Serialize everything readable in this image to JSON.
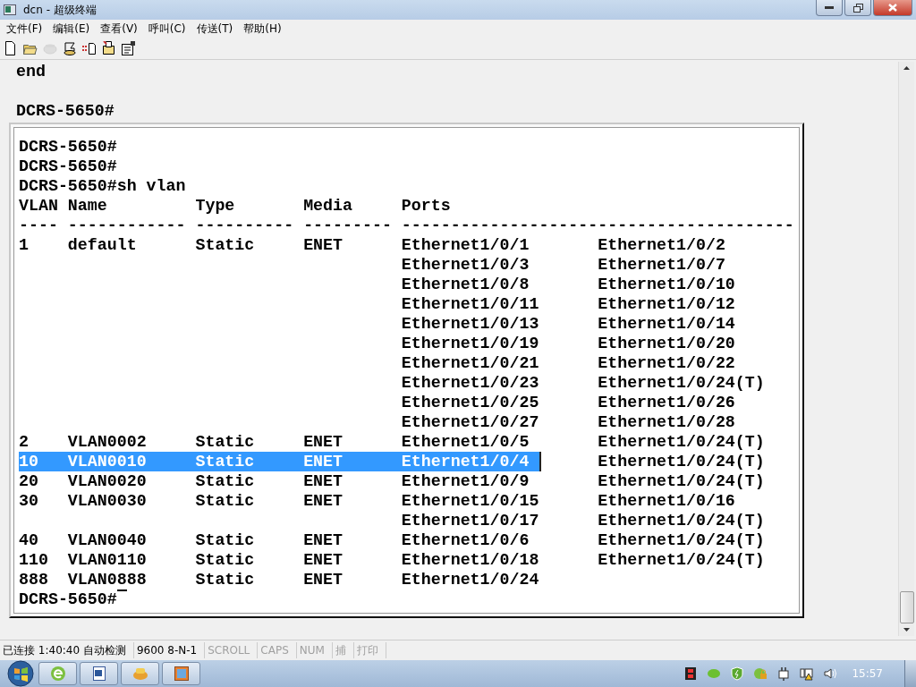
{
  "window": {
    "title": "dcn - 超级终端"
  },
  "menu": [
    "文件(F)",
    "编辑(E)",
    "查看(V)",
    "呼叫(C)",
    "传送(T)",
    "帮助(H)"
  ],
  "toolbar": [
    {
      "kind": "new"
    },
    {
      "kind": "open"
    },
    {
      "kind": "call",
      "disabled": true
    },
    {
      "kind": "hangup",
      "disabled": false
    },
    {
      "kind": "send"
    },
    {
      "kind": "receive"
    },
    {
      "kind": "properties"
    }
  ],
  "terminal": {
    "upper_lines": [
      "end",
      "DCRS-5650#"
    ],
    "prompt_lines": [
      "DCRS-5650#",
      "DCRS-5650#",
      "DCRS-5650#sh vlan"
    ],
    "vlan_table": {
      "columns": [
        "VLAN",
        "Name",
        "Type",
        "Media",
        "Ports"
      ],
      "separators": [
        "----",
        "------------",
        "----------",
        "---------",
        "----------------------------------------"
      ],
      "rows": [
        {
          "vlan": "1",
          "name": "default",
          "type": "Static",
          "media": "ENET",
          "selected": false,
          "ports": [
            "Ethernet1/0/1",
            "Ethernet1/0/2",
            "Ethernet1/0/3",
            "Ethernet1/0/7",
            "Ethernet1/0/8",
            "Ethernet1/0/10",
            "Ethernet1/0/11",
            "Ethernet1/0/12",
            "Ethernet1/0/13",
            "Ethernet1/0/14",
            "Ethernet1/0/19",
            "Ethernet1/0/20",
            "Ethernet1/0/21",
            "Ethernet1/0/22",
            "Ethernet1/0/23",
            "Ethernet1/0/24(T)",
            "Ethernet1/0/25",
            "Ethernet1/0/26",
            "Ethernet1/0/27",
            "Ethernet1/0/28"
          ]
        },
        {
          "vlan": "2",
          "name": "VLAN0002",
          "type": "Static",
          "media": "ENET",
          "selected": false,
          "ports": [
            "Ethernet1/0/5",
            "Ethernet1/0/24(T)"
          ]
        },
        {
          "vlan": "10",
          "name": "VLAN0010",
          "type": "Static",
          "media": "ENET",
          "selected": true,
          "ports": [
            "Ethernet1/0/4",
            "Ethernet1/0/24(T)"
          ]
        },
        {
          "vlan": "20",
          "name": "VLAN0020",
          "type": "Static",
          "media": "ENET",
          "selected": false,
          "ports": [
            "Ethernet1/0/9",
            "Ethernet1/0/24(T)"
          ]
        },
        {
          "vlan": "30",
          "name": "VLAN0030",
          "type": "Static",
          "media": "ENET",
          "selected": false,
          "ports": [
            "Ethernet1/0/15",
            "Ethernet1/0/16",
            "Ethernet1/0/17",
            "Ethernet1/0/24(T)"
          ]
        },
        {
          "vlan": "40",
          "name": "VLAN0040",
          "type": "Static",
          "media": "ENET",
          "selected": false,
          "ports": [
            "Ethernet1/0/6",
            "Ethernet1/0/24(T)"
          ]
        },
        {
          "vlan": "110",
          "name": "VLAN0110",
          "type": "Static",
          "media": "ENET",
          "selected": false,
          "ports": [
            "Ethernet1/0/18",
            "Ethernet1/0/24(T)"
          ]
        },
        {
          "vlan": "888",
          "name": "VLAN0888",
          "type": "Static",
          "media": "ENET",
          "selected": false,
          "ports": [
            "Ethernet1/0/24"
          ]
        }
      ]
    },
    "final_prompt": "DCRS-5650#"
  },
  "status_bar": [
    {
      "text": "已连接 1:40:40 自动检测",
      "disabled": false
    },
    {
      "text": "9600 8-N-1",
      "disabled": false
    },
    {
      "text": "SCROLL",
      "disabled": true
    },
    {
      "text": "CAPS",
      "disabled": true
    },
    {
      "text": "NUM",
      "disabled": true
    },
    {
      "text": "捕",
      "disabled": true
    },
    {
      "text": "打印",
      "disabled": true
    }
  ],
  "taskbar": {
    "apps": [
      {
        "kind": "browser"
      },
      {
        "kind": "word"
      },
      {
        "kind": "hyperterminal"
      },
      {
        "kind": "window"
      }
    ],
    "tray": [
      {
        "kind": "film"
      },
      {
        "kind": "blob"
      },
      {
        "kind": "shield"
      },
      {
        "kind": "lock"
      },
      {
        "kind": "plug"
      },
      {
        "kind": "network"
      },
      {
        "kind": "speaker"
      }
    ],
    "clock": "15:57"
  }
}
